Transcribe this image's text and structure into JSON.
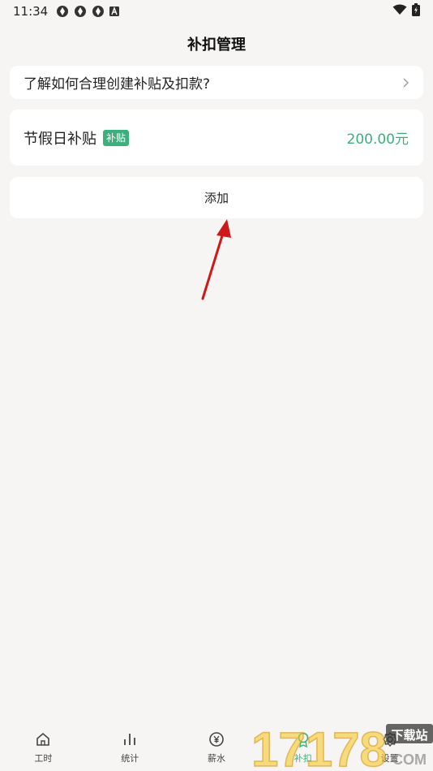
{
  "status_bar": {
    "time": "11:34",
    "left_icons": [
      "aperture-icon",
      "aperture-icon",
      "aperture-icon",
      "a-box-icon"
    ],
    "right_icons": [
      "wifi-icon",
      "battery-charging-icon"
    ]
  },
  "header": {
    "title": "补扣管理"
  },
  "help": {
    "text": "了解如何合理创建补贴及扣款?"
  },
  "item": {
    "name": "节假日补贴",
    "badge": "补贴",
    "amount": "200.00元"
  },
  "add": {
    "label": "添加"
  },
  "nav": [
    {
      "label": "工时",
      "icon": "home-icon"
    },
    {
      "label": "统计",
      "icon": "bar-chart-icon"
    },
    {
      "label": "薪水",
      "icon": "yen-coin-icon"
    },
    {
      "label": "补扣",
      "icon": "award-icon",
      "active": true
    },
    {
      "label": "设置",
      "icon": "gear-icon"
    }
  ],
  "watermark": {
    "text": "下载站",
    "brand": "17178",
    "domain": "COM"
  },
  "colors": {
    "accent": "#3bb07c",
    "background": "#f6f5f3",
    "arrow": "#d01818"
  }
}
